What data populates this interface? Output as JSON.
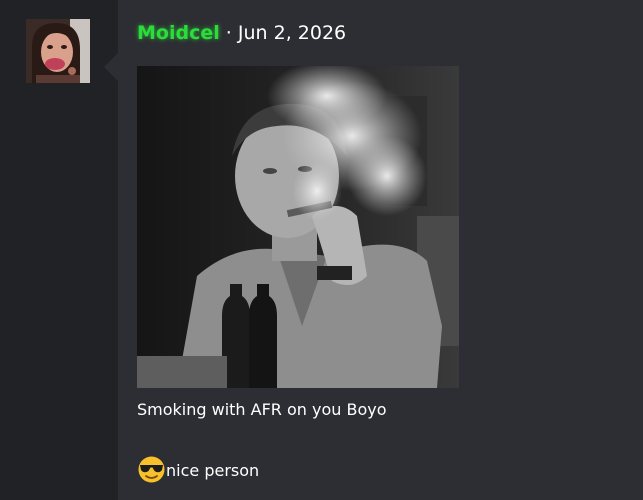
{
  "post": {
    "author": "Moidcel",
    "separator": "·",
    "date": "Jun 2, 2026",
    "caption": "Smoking with AFR on you Boyo",
    "reply_text": "nice person",
    "reply_emoji": "sunglasses-emoji"
  },
  "colors": {
    "username": "#2bdc3b",
    "post_background": "#2d2e33",
    "page_background": "#212226",
    "text": "#ffffff"
  }
}
